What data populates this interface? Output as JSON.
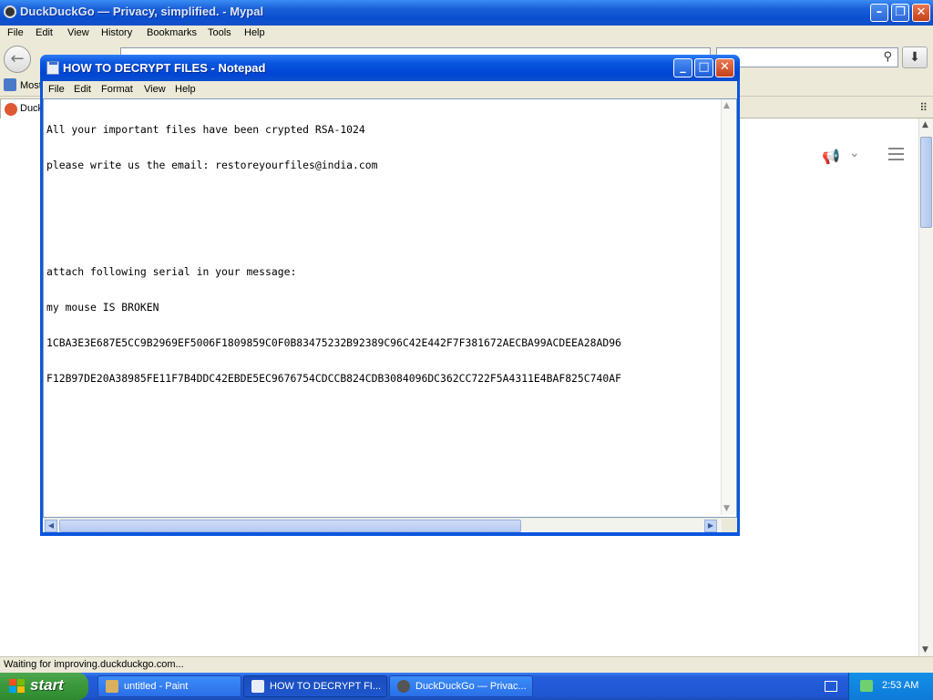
{
  "browser": {
    "title": "DuckDuckGo — Privacy, simplified. - Mypal",
    "menu": [
      "File",
      "Edit",
      "View",
      "History",
      "Bookmarks",
      "Tools",
      "Help"
    ],
    "bookmark_label": "Most",
    "tab_label": "Duck",
    "status_text": "Waiting for improving.duckduckgo.com..."
  },
  "notepad": {
    "title": "HOW TO DECRYPT FILES - Notepad",
    "menu": [
      "File",
      "Edit",
      "Format",
      "View",
      "Help"
    ],
    "lines": [
      "All your important files have been crypted RSA-1024",
      "please write us the email: restoreyourfiles@india.com",
      "",
      "",
      "attach following serial in your message:",
      "my mouse IS BROKEN",
      "1CBA3E3E687E5CC9B2969EF5006F1809859C0F0B83475232B92389C96C42E442F7F381672AECBA99ACDEEA28AD96",
      "F12B97DE20A38985FE11F7B4DDC42EBDE5EC9676754CDCCB824CDB3084096DC362CC722F5A4311E4BAF825C740AF"
    ]
  },
  "taskbar": {
    "start_label": "start",
    "tasks": [
      {
        "label": "untitled - Paint",
        "icon": "paint-icon"
      },
      {
        "label": "HOW TO DECRYPT FI...",
        "icon": "notepad-icon"
      },
      {
        "label": "DuckDuckGo — Privac...",
        "icon": "mypal-icon"
      }
    ],
    "clock": "2:53 AM"
  },
  "colors": {
    "xp_blue": "#0a56e0",
    "start_green": "#3c9a3c",
    "ddg_orange": "#de5833"
  }
}
